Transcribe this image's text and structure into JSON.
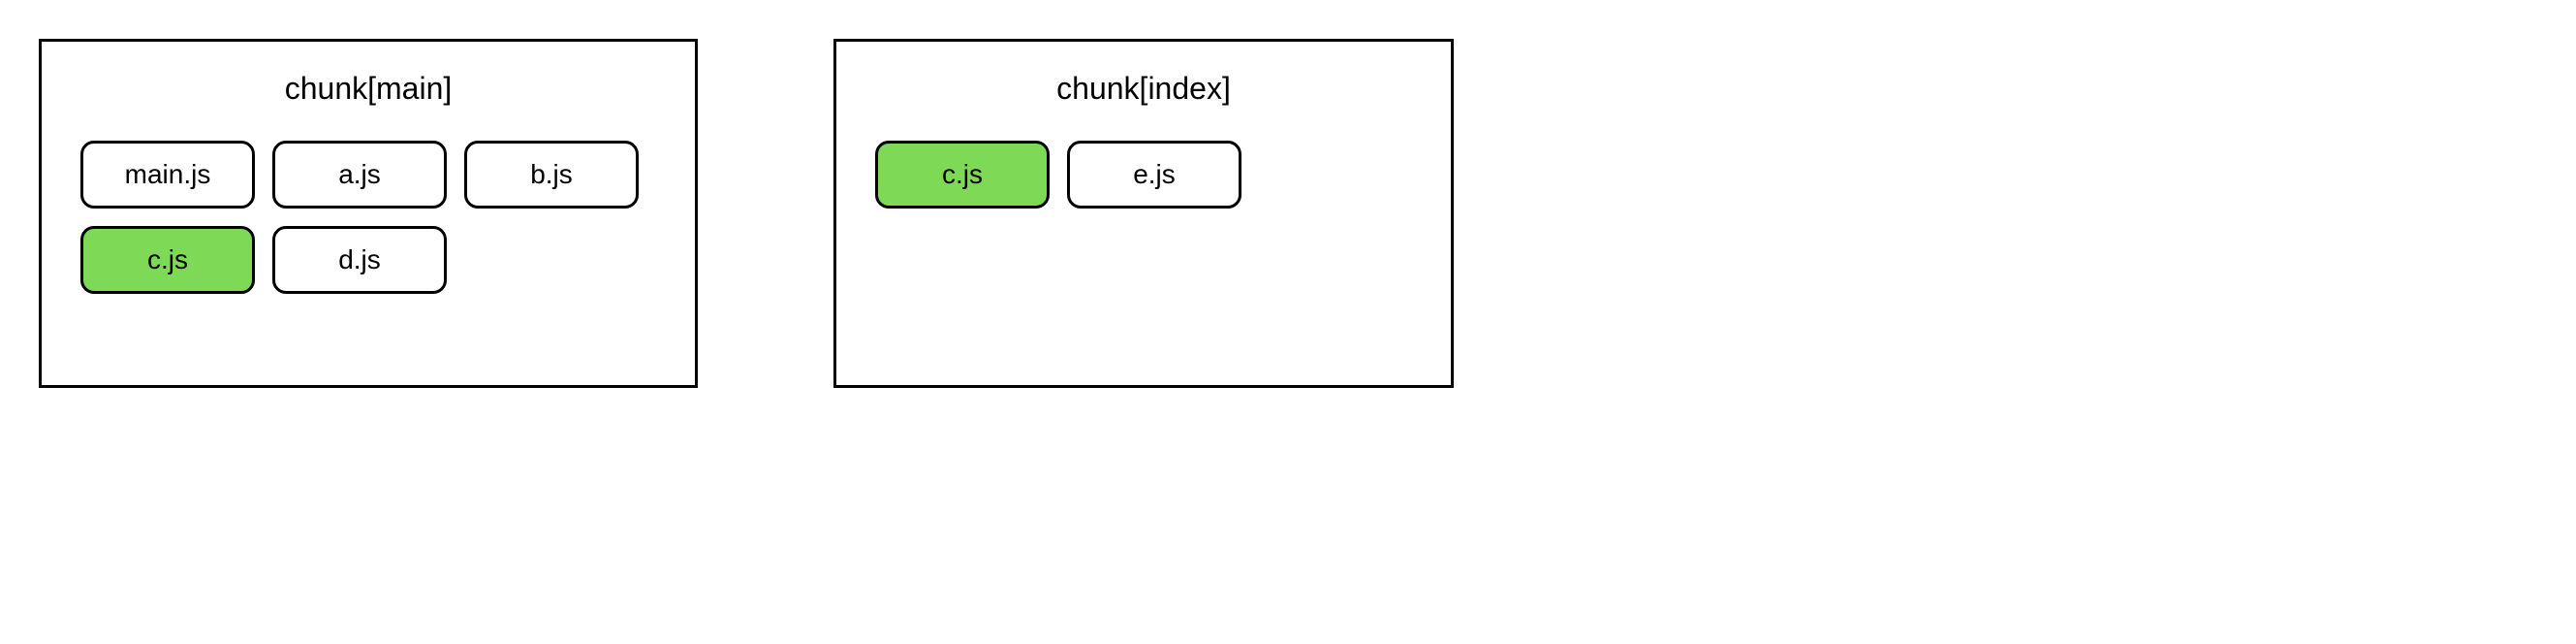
{
  "colors": {
    "highlight": "#7ed957",
    "border": "#000000",
    "background": "#ffffff"
  },
  "chunks": [
    {
      "id": "main",
      "title": "chunk[main]",
      "modules": [
        {
          "label": "main.js",
          "highlighted": false
        },
        {
          "label": "a.js",
          "highlighted": false
        },
        {
          "label": "b.js",
          "highlighted": false
        },
        {
          "label": "c.js",
          "highlighted": true
        },
        {
          "label": "d.js",
          "highlighted": false
        }
      ]
    },
    {
      "id": "index",
      "title": "chunk[index]",
      "modules": [
        {
          "label": "c.js",
          "highlighted": true
        },
        {
          "label": "e.js",
          "highlighted": false
        }
      ]
    }
  ]
}
